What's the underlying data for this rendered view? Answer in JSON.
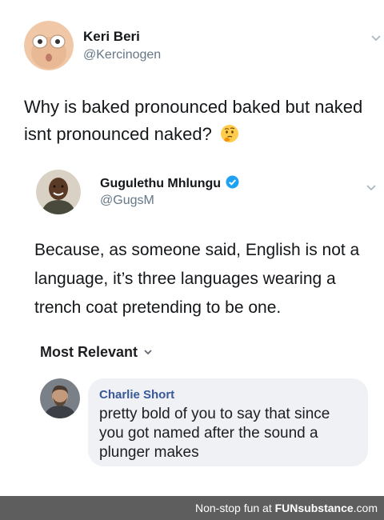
{
  "tweet1": {
    "name": "Keri Beri",
    "handle": "@Kercinogen",
    "text": "Why is baked pronounced baked but naked isnt pronounced naked?",
    "emoji": "🤔"
  },
  "tweet2": {
    "name": "Gugulethu Mhlungu",
    "handle": "@GugsM",
    "text": "Because, as someone said, English is not a language, it’s three languages wearing a trench coat pretending to be one."
  },
  "comments": {
    "sort_label": "Most Relevant",
    "comment": {
      "name": "Charlie Short",
      "text": "pretty bold of you to say that since you got named after the sound a plunger makes"
    }
  },
  "footer": {
    "text": "Non-stop fun at",
    "brand": "FUNsubstance",
    "domain": ".com"
  },
  "colors": {
    "verified": "#1da1f2",
    "handle": "#657786",
    "comment_name": "#385898",
    "bubble": "#eff1f4",
    "footer_bg": "#5e5e5e"
  }
}
